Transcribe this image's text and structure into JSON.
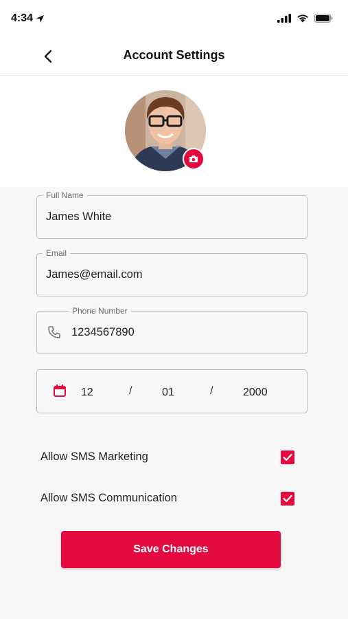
{
  "status_bar": {
    "time": "4:34",
    "icons": [
      "location-arrow-icon",
      "cellular-signal-icon",
      "wifi-icon",
      "battery-icon"
    ]
  },
  "header": {
    "title": "Account Settings",
    "back_icon": "chevron-left-icon"
  },
  "profile": {
    "avatar": "avatar-photo",
    "camera_icon": "camera-icon"
  },
  "form": {
    "full_name": {
      "label": "Full Name",
      "value": "James White"
    },
    "email": {
      "label": "Email",
      "value": "James@email.com"
    },
    "phone": {
      "label": "Phone Number",
      "value": "1234567890",
      "icon": "phone-icon"
    },
    "birthdate": {
      "icon": "calendar-icon",
      "month": "12",
      "day": "01",
      "year": "2000",
      "separator": "/"
    }
  },
  "preferences": [
    {
      "label": "Allow SMS Marketing",
      "checked": true
    },
    {
      "label": "Allow SMS Communication",
      "checked": true
    }
  ],
  "actions": {
    "save_label": "Save Changes"
  },
  "colors": {
    "accent": "#e4093f",
    "background": "#f7f7f7",
    "surface": "#ffffff"
  }
}
